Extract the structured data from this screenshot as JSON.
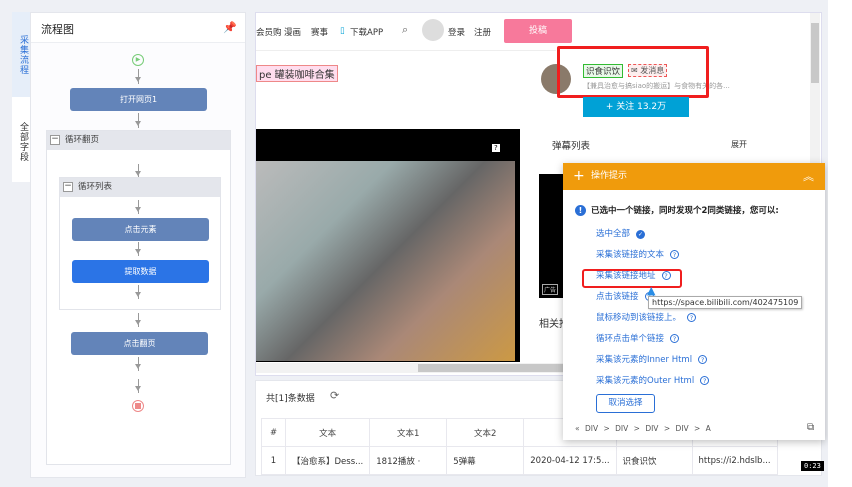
{
  "side_tabs": [
    "采集流程",
    "全部字段"
  ],
  "flow": {
    "title": "流程图",
    "nodes": {
      "open": "打开网页1",
      "loop_page": "循环翻页",
      "loop_list": "循环列表",
      "click": "点击元素",
      "extract": "提取数据",
      "next": "点击翻页"
    }
  },
  "browser": {
    "nav": [
      "会员购",
      "漫画",
      "赛事",
      "下载APP",
      "登录",
      "注册"
    ],
    "upload": "投稿",
    "video_title": "pe 罐装咖啡合集",
    "uploader": {
      "name": "识食识饮",
      "message": "发消息",
      "desc": "【兼具治愈与搞siao的搬运】与食物有关的各...",
      "follow": "+ 关注 13.2万"
    },
    "danmu": "弹幕列表",
    "expand": "展开",
    "ad": "广告",
    "related": "相关推"
  },
  "data": {
    "count": "共[1]条数据",
    "columns": [
      "#",
      "文本",
      "文本1",
      "文本2",
      "",
      "",
      ""
    ],
    "rows": [
      [
        "1",
        "【治愈系】Dess...",
        "1812播放 ·",
        "5弹幕",
        "2020-04-12 17:5...",
        "识食识饮",
        "https://i2.hdslb..."
      ]
    ]
  },
  "popup": {
    "title": "操作提示",
    "info": "已选中一个链接，同时发现个2同类链接，您可以:",
    "options": [
      "选中全部",
      "采集该链接的文本",
      "采集该链接地址",
      "点击该链接",
      "鼠标移动到该链接上。",
      "循环点击单个链接",
      "采集该元素的Inner Html",
      "采集该元素的Outer Html"
    ],
    "tooltip": "https://space.bilibili.com/402475109",
    "cancel": "取消选择",
    "breadcrumb": "DIV > DIV > DIV > DIV > A"
  },
  "video_time": "0:23",
  "colors": {
    "accent": "#2a6fd6",
    "orange": "#f09b0c",
    "bili_pink": "#f7799b",
    "bili_blue": "#00a1d6"
  }
}
